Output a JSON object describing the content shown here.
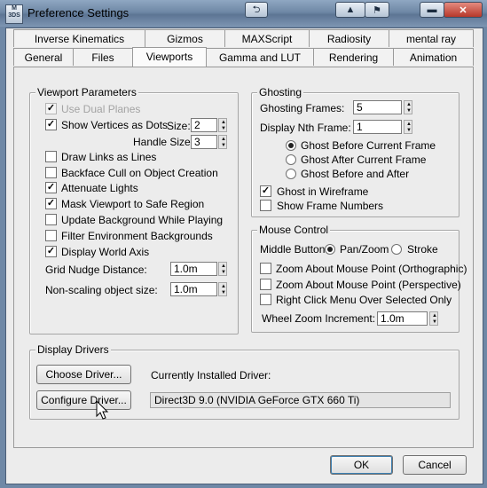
{
  "window": {
    "title": "Preference Settings",
    "icon_text": "M\n3DS"
  },
  "tabs_row1": [
    "Inverse Kinematics",
    "Gizmos",
    "MAXScript",
    "Radiosity",
    "mental ray"
  ],
  "tabs_row2": [
    "General",
    "Files",
    "Viewports",
    "Gamma and LUT",
    "Rendering",
    "Animation"
  ],
  "active_tab": "Viewports",
  "viewport_params": {
    "legend": "Viewport Parameters",
    "use_dual_planes": "Use Dual Planes",
    "show_vertices": "Show Vertices as Dots",
    "size_label": "Size:",
    "size_value": "2",
    "handle_size_label": "Handle Size:",
    "handle_size_value": "3",
    "draw_links": "Draw Links as Lines",
    "backface_cull": "Backface Cull on Object Creation",
    "attenuate_lights": "Attenuate Lights",
    "mask_viewport": "Mask Viewport to Safe Region",
    "update_background": "Update Background While Playing",
    "filter_env": "Filter Environment Backgrounds",
    "display_world_axis": "Display World Axis",
    "grid_nudge_label": "Grid Nudge Distance:",
    "grid_nudge_value": "1.0m",
    "non_scaling_label": "Non-scaling object size:",
    "non_scaling_value": "1.0m",
    "checked": {
      "use_dual_planes": true,
      "show_vertices": true,
      "draw_links": false,
      "backface_cull": false,
      "attenuate_lights": true,
      "mask_viewport": true,
      "update_background": false,
      "filter_env": false,
      "display_world_axis": true
    }
  },
  "ghosting": {
    "legend": "Ghosting",
    "frames_label": "Ghosting Frames:",
    "frames_value": "5",
    "nth_label": "Display Nth Frame:",
    "nth_value": "1",
    "before": "Ghost Before Current Frame",
    "after": "Ghost After Current Frame",
    "before_after": "Ghost Before and After",
    "selected": "before",
    "wireframe": "Ghost in Wireframe",
    "wireframe_checked": true,
    "frame_numbers": "Show Frame Numbers",
    "frame_numbers_checked": false
  },
  "mouse": {
    "legend": "Mouse Control",
    "middle_label": "Middle Button:",
    "pan_zoom": "Pan/Zoom",
    "stroke": "Stroke",
    "selected": "pan_zoom",
    "zoom_ortho": "Zoom About Mouse Point (Orthographic)",
    "zoom_persp": "Zoom About Mouse Point (Perspective)",
    "right_click": "Right Click Menu Over Selected Only",
    "wheel_label": "Wheel Zoom Increment:",
    "wheel_value": "1.0m"
  },
  "drivers": {
    "legend": "Display Drivers",
    "choose": "Choose Driver...",
    "configure": "Configure Driver...",
    "installed_label": "Currently Installed Driver:",
    "installed_value": "Direct3D 9.0 (NVIDIA GeForce GTX 660 Ti)"
  },
  "buttons": {
    "ok": "OK",
    "cancel": "Cancel"
  },
  "colors": {
    "title_bar": "#6f88a6",
    "close_button": "#c64a3c"
  }
}
